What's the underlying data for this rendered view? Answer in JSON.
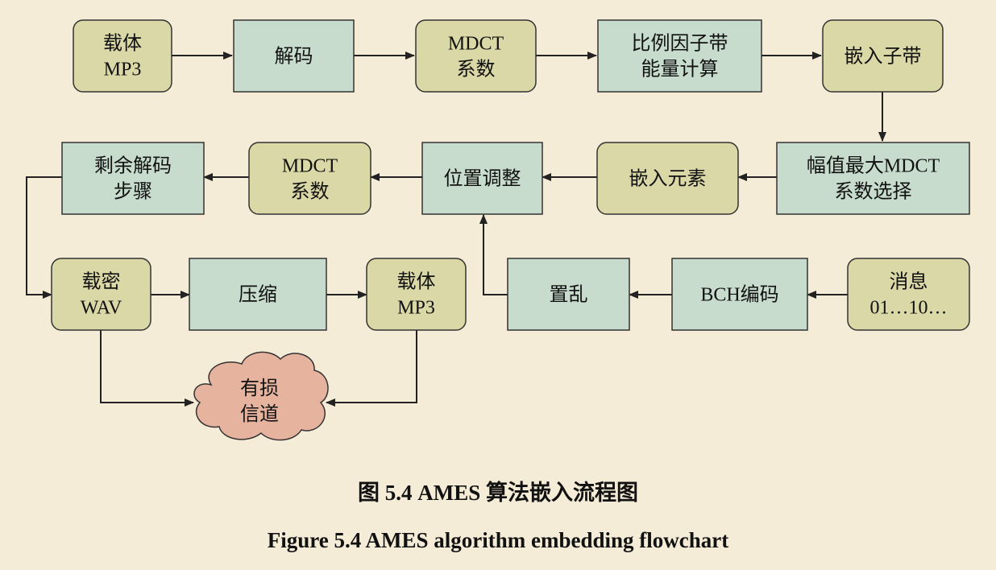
{
  "colors": {
    "background": "#f5ecd7",
    "olive_box": "#d9d8a6",
    "teal_box": "#c7dccd",
    "cloud": "#e6b39e",
    "stroke": "#333333"
  },
  "nodes": {
    "carrier_mp3_top": [
      "载体",
      "MP3"
    ],
    "decode": [
      "解码"
    ],
    "mdct_coeff_top": [
      "MDCT",
      "系数"
    ],
    "subband_energy": [
      "比例因子带",
      "能量计算"
    ],
    "embed_subband": [
      "嵌入子带"
    ],
    "max_mdct_select": [
      "幅值最大MDCT",
      "系数选择"
    ],
    "embed_element": [
      "嵌入元素"
    ],
    "position_adjust": [
      "位置调整"
    ],
    "mdct_coeff_mid": [
      "MDCT",
      "系数"
    ],
    "remaining_decode": [
      "剩余解码",
      "步骤"
    ],
    "stego_wav": [
      "载密",
      "WAV"
    ],
    "compress": [
      "压缩"
    ],
    "carrier_mp3_bottom": [
      "载体",
      "MP3"
    ],
    "scramble": [
      "置乱"
    ],
    "bch_encode": [
      "BCH编码"
    ],
    "message": [
      "消息",
      "01…10…"
    ],
    "lossy_channel": [
      "有损",
      "信道"
    ]
  },
  "caption": {
    "chinese": "图 5.4 AMES 算法嵌入流程图",
    "english": "Figure 5.4 AMES algorithm embedding flowchart"
  }
}
